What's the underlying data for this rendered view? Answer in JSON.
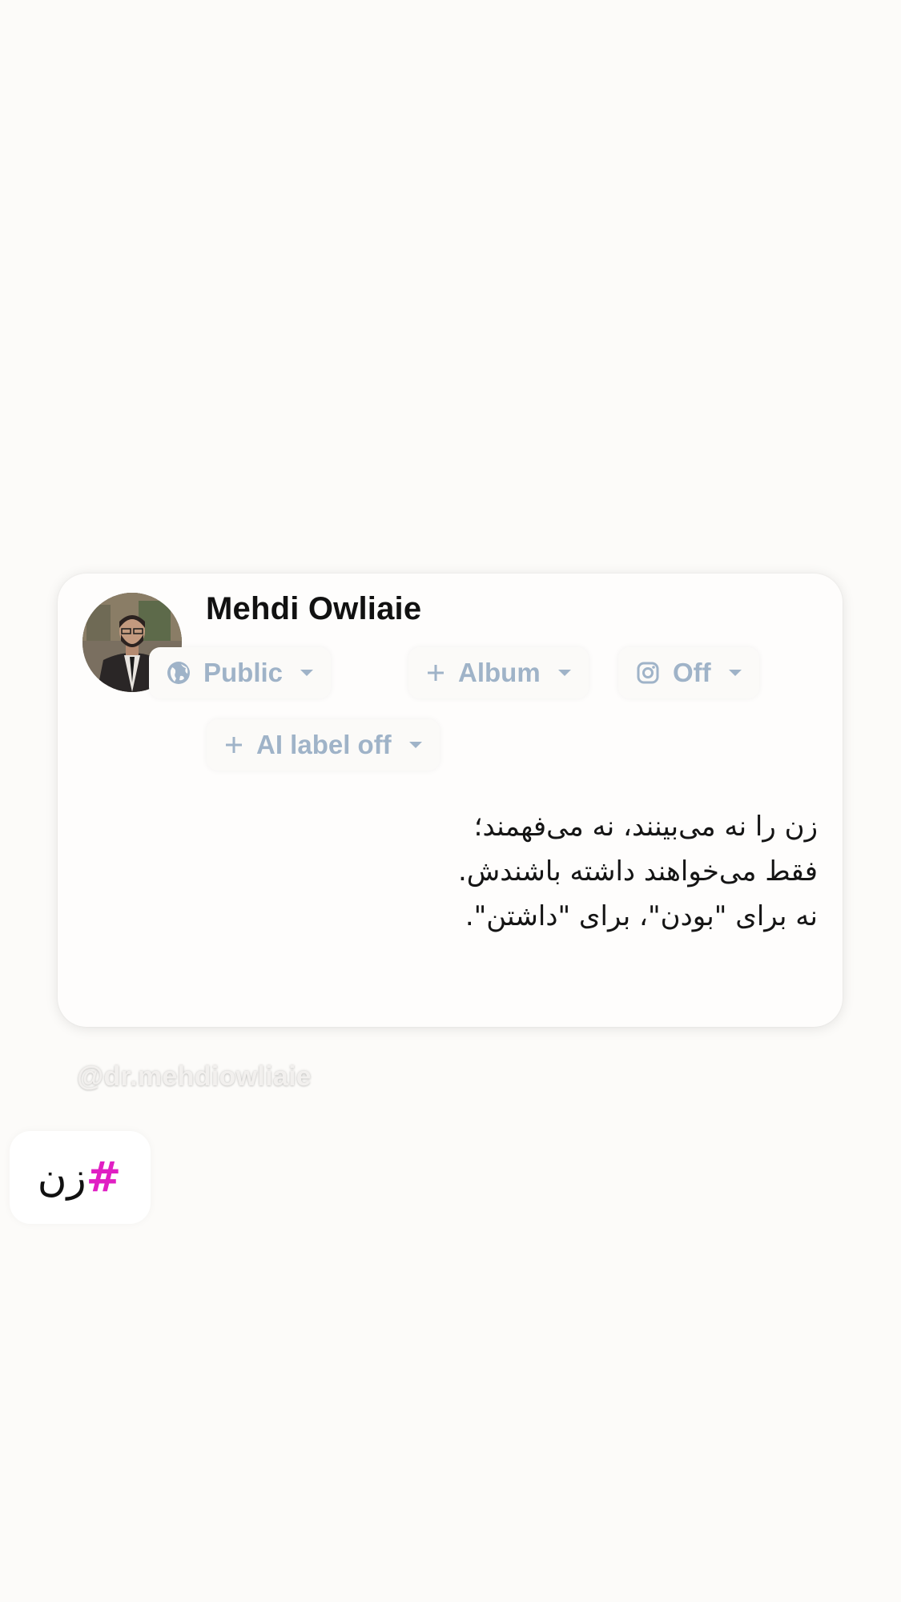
{
  "profile": {
    "name": "Mehdi Owliaie",
    "avatar_alt": "profile photo"
  },
  "chips": {
    "audience": {
      "label": "Public",
      "icon": "globe-icon"
    },
    "album": {
      "label": "Album",
      "icon": "plus-icon"
    },
    "instagram": {
      "label": "Off",
      "icon": "instagram-icon"
    },
    "ai_label": {
      "label": "AI label off",
      "icon": "plus-icon"
    }
  },
  "post": {
    "lines": [
      "زن را نه می‌بینند، نه می‌فهمند؛",
      "فقط می‌خواهند داشته باشندش.",
      "نه برای \"بودن\"، برای \"داشتن\"."
    ]
  },
  "watermark": {
    "handle": "@dr.mehdiowliaie"
  },
  "hashtag": {
    "symbol": "#",
    "word": "زن"
  },
  "colors": {
    "background": "#fcfbf9",
    "chip_text": "#9fb3c8",
    "hashtag_symbol": "#e01fc3"
  }
}
